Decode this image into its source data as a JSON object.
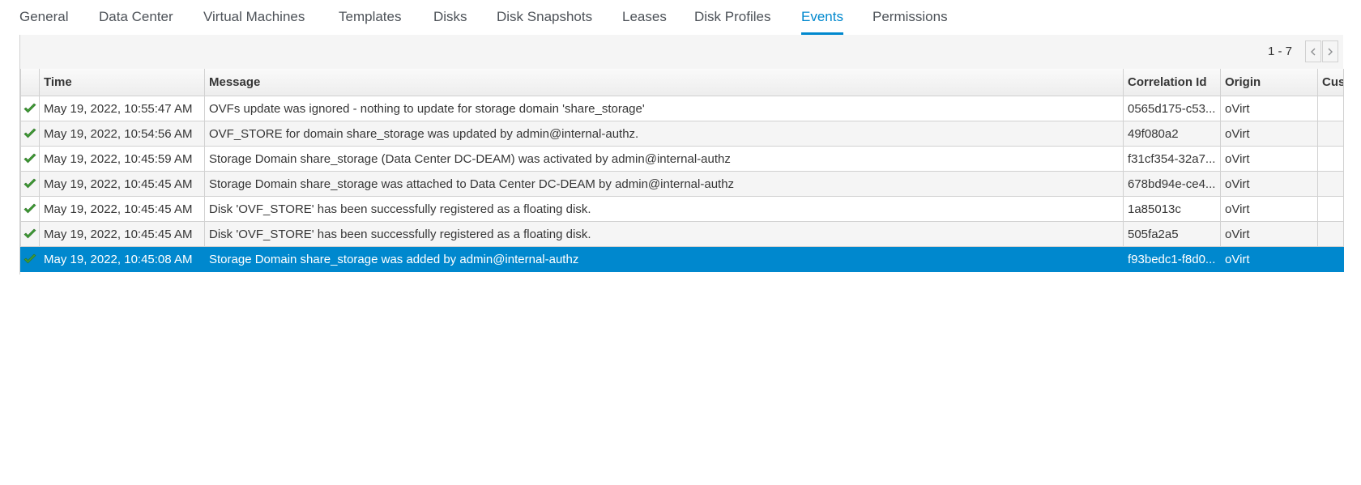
{
  "tabs": [
    {
      "label": "General",
      "active": false
    },
    {
      "label": "Data Center",
      "active": false
    },
    {
      "label": "Virtual Machines",
      "active": false
    },
    {
      "label": "Templates",
      "active": false
    },
    {
      "label": "Disks",
      "active": false
    },
    {
      "label": "Disk Snapshots",
      "active": false
    },
    {
      "label": "Leases",
      "active": false
    },
    {
      "label": "Disk Profiles",
      "active": false
    },
    {
      "label": "Events",
      "active": true
    },
    {
      "label": "Permissions",
      "active": false
    }
  ],
  "pager": {
    "range": "1 - 7",
    "prev_icon": "chevron-left-icon",
    "next_icon": "chevron-right-icon"
  },
  "table": {
    "columns": [
      "",
      "Time",
      "Message",
      "Correlation Id",
      "Origin",
      "Cus"
    ],
    "rows": [
      {
        "status_icon": "check-icon",
        "time": "May 19, 2022, 10:55:47 AM",
        "message": "OVFs update was ignored - nothing to update for storage domain 'share_storage'",
        "correlation_id": "0565d175-c53...",
        "origin": "oVirt",
        "custom": "",
        "selected": false
      },
      {
        "status_icon": "check-icon",
        "time": "May 19, 2022, 10:54:56 AM",
        "message": "OVF_STORE for domain share_storage was updated by admin@internal-authz.",
        "correlation_id": "49f080a2",
        "origin": "oVirt",
        "custom": "",
        "selected": false
      },
      {
        "status_icon": "check-icon",
        "time": "May 19, 2022, 10:45:59 AM",
        "message": "Storage Domain share_storage (Data Center DC-DEAM) was activated by admin@internal-authz",
        "correlation_id": "f31cf354-32a7...",
        "origin": "oVirt",
        "custom": "",
        "selected": false
      },
      {
        "status_icon": "check-icon",
        "time": "May 19, 2022, 10:45:45 AM",
        "message": "Storage Domain share_storage was attached to Data Center DC-DEAM by admin@internal-authz",
        "correlation_id": "678bd94e-ce4...",
        "origin": "oVirt",
        "custom": "",
        "selected": false
      },
      {
        "status_icon": "check-icon",
        "time": "May 19, 2022, 10:45:45 AM",
        "message": "Disk 'OVF_STORE' has been successfully registered as a floating disk.",
        "correlation_id": "1a85013c",
        "origin": "oVirt",
        "custom": "",
        "selected": false
      },
      {
        "status_icon": "check-icon",
        "time": "May 19, 2022, 10:45:45 AM",
        "message": "Disk 'OVF_STORE' has been successfully registered as a floating disk.",
        "correlation_id": "505fa2a5",
        "origin": "oVirt",
        "custom": "",
        "selected": false
      },
      {
        "status_icon": "check-icon",
        "time": "May 19, 2022, 10:45:08 AM",
        "message": "Storage Domain share_storage was added by admin@internal-authz",
        "correlation_id": "f93bedc1-f8d0...",
        "origin": "oVirt",
        "custom": "",
        "selected": true
      }
    ]
  },
  "colors": {
    "accent": "#0088ce",
    "check_green": "#3f9c35"
  }
}
